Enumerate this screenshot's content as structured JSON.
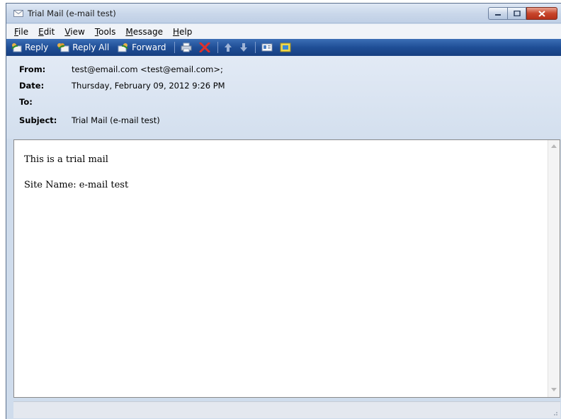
{
  "window": {
    "title": "Trial Mail (e-mail test)"
  },
  "menu": [
    "File",
    "Edit",
    "View",
    "Tools",
    "Message",
    "Help"
  ],
  "menu_hotkeys": [
    "F",
    "E",
    "V",
    "T",
    "M",
    "H"
  ],
  "toolbar": {
    "reply_label": "Reply",
    "reply_all_label": "Reply All",
    "forward_label": "Forward"
  },
  "headers": {
    "from_label": "From:",
    "from_value": "test@email.com <test@email.com>;",
    "date_label": "Date:",
    "date_value": "Thursday, February 09, 2012 9:26 PM",
    "to_label": "To:",
    "to_value": "",
    "subject_label": "Subject:",
    "subject_value": "Trial Mail (e-mail test)"
  },
  "message": {
    "line1": "This is a trial mail",
    "line2": "Site Name: e-mail test"
  },
  "colors": {
    "toolbar": "#1f4e96",
    "header_bg": "#dbe5f1",
    "close_button": "#c8452b"
  }
}
